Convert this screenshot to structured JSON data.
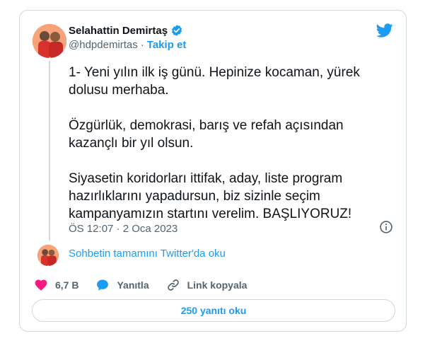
{
  "author": {
    "name": "Selahattin Demirtaş",
    "handle": "@hdpdemirtas",
    "separator": "·",
    "follow_label": "Takip et"
  },
  "tweet": {
    "text": "1- Yeni yılın ilk iş günü. Hepinize kocaman, yürek dolusu merhaba.\n\nÖzgürlük, demokrasi, barış ve refah açısından kazançlı bir yıl olsun.\n\nSiyasetin koridorları ittifak, aday, liste program hazırlıklarını yapadursun, biz sizinle seçim kampanyamızın startını verelim. BAŞLIYORUZ!",
    "timestamp": "ÖS 12:07 · 2 Oca 2023"
  },
  "thread_link": "Sohbetin tamamını Twitter'da oku",
  "actions": {
    "likes": "6,7 B",
    "reply_label": "Yanıtla",
    "copy_link_label": "Link kopyala"
  },
  "read_replies_label": "250 yanıtı oku",
  "colors": {
    "accent": "#1d9bf0",
    "like": "#f91880",
    "secondary_text": "#536471",
    "border": "#cfd9de"
  },
  "icons": [
    "verified-badge-icon",
    "twitter-bird-icon",
    "info-icon",
    "heart-icon",
    "reply-bubble-icon",
    "link-icon"
  ]
}
